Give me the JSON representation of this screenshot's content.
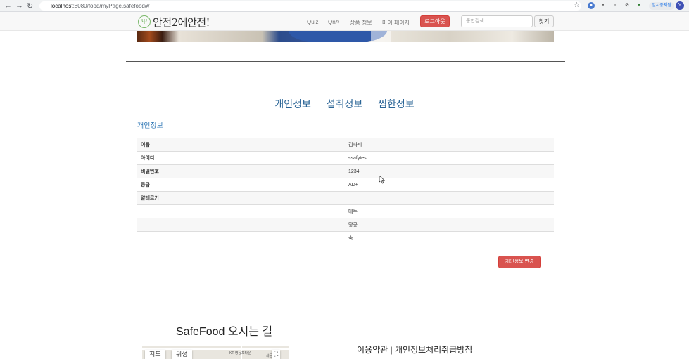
{
  "browser": {
    "url_host": "localhost",
    "url_path": ":8080/food/myPage.safefood#/",
    "incognito_label": "일시중지됨",
    "avatar_letter": "Y"
  },
  "navbar": {
    "logo_text": "안전2에안전!",
    "menu": [
      "Quiz",
      "QnA",
      "상품 정보",
      "마이 페이지"
    ],
    "logout_label": "로그아웃",
    "search_placeholder": "통합검색",
    "search_label": "찾기",
    "accent": "#d9534f"
  },
  "tabs": [
    "개인정보",
    "섭취정보",
    "찜한정보"
  ],
  "section_title": "개인정보",
  "profile": [
    {
      "label": "이름",
      "value": "김싸피"
    },
    {
      "label": "아이디",
      "value": "ssafytest"
    },
    {
      "label": "비밀번호",
      "value": "1234"
    },
    {
      "label": "등급",
      "value": "AD+"
    },
    {
      "label": "알레르기",
      "value": ""
    }
  ],
  "allergies": [
    "대두",
    "땅콩",
    "숙"
  ],
  "edit_button": "개인정보 변경",
  "footer": {
    "map_title": "SafeFood 오시는 길",
    "map_tabs": [
      "지도",
      "위성"
    ],
    "map_label": "KT 영등포타운",
    "map_label2": "세문동",
    "terms": "이용약관 | 개인정보처리취급방침"
  }
}
